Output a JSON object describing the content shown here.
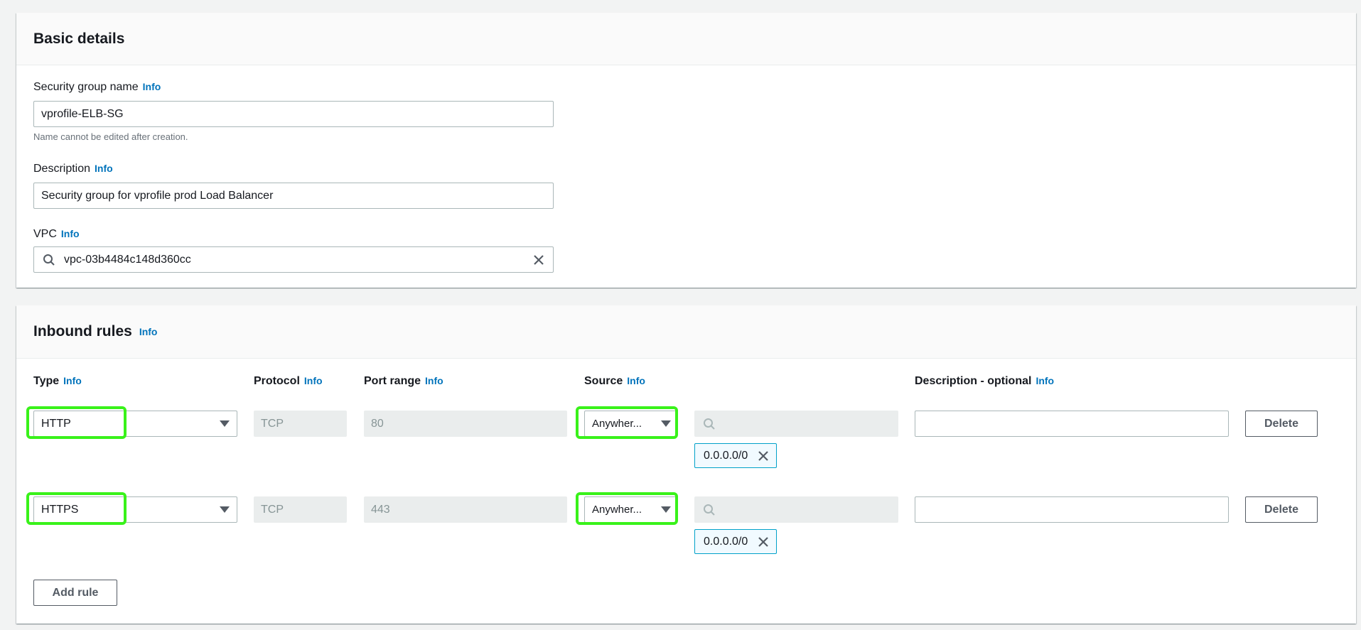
{
  "basic_details": {
    "title": "Basic details",
    "name_label": "Security group name",
    "name_info": "Info",
    "name_value": "vprofile-ELB-SG",
    "name_hint": "Name cannot be edited after creation.",
    "description_label": "Description",
    "description_info": "Info",
    "description_value": "Security group for vprofile prod Load Balancer",
    "vpc_label": "VPC",
    "vpc_info": "Info",
    "vpc_value": "vpc-03b4484c148d360cc"
  },
  "inbound_rules": {
    "title": "Inbound rules",
    "title_info": "Info",
    "columns": {
      "type": "Type",
      "protocol": "Protocol",
      "port_range": "Port range",
      "source": "Source",
      "description": "Description - optional",
      "info": "Info"
    },
    "rows": [
      {
        "type": "HTTP",
        "protocol": "TCP",
        "port_range": "80",
        "source": "Anywher...",
        "cidr": "0.0.0.0/0",
        "description": "",
        "delete_label": "Delete"
      },
      {
        "type": "HTTPS",
        "protocol": "TCP",
        "port_range": "443",
        "source": "Anywher...",
        "cidr": "0.0.0.0/0",
        "description": "",
        "delete_label": "Delete"
      }
    ],
    "add_rule_label": "Add rule"
  },
  "colors": {
    "accent": "#0073bb",
    "highlight": "#39f21a",
    "token_border": "#00a1c9"
  },
  "icons": [
    "search-icon",
    "clear-icon",
    "chevron-down-icon",
    "remove-token-icon"
  ]
}
